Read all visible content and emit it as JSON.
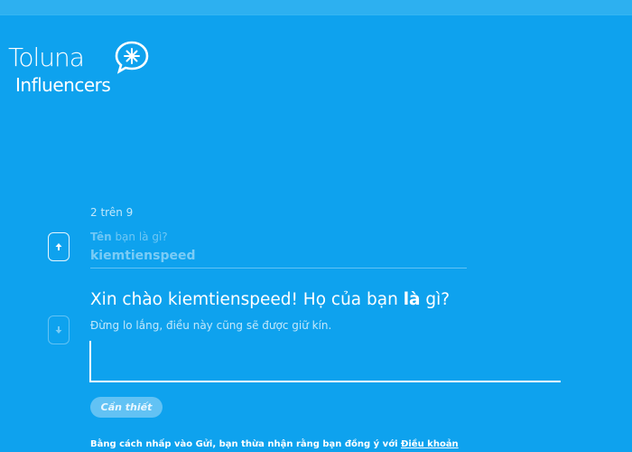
{
  "brand": {
    "line1": "Toluna",
    "line2": "Influencers"
  },
  "survey": {
    "counter": "2 trên 9",
    "previous": {
      "label_bold": "Tên",
      "label_rest": " bạn là gì?",
      "answer": "kiemtienspeed"
    },
    "current": {
      "question_start": "Xin chào kiemtienspeed! Họ của bạn ",
      "question_bold": "là",
      "question_end": " gì?",
      "hint": "Đừng lo lắng, điều này cũng sẽ được giữ kín.",
      "input_value": "",
      "input_placeholder": ""
    },
    "required_label": "Cần thiết",
    "terms_text": "Bằng cách nhấp vào Gửi, bạn thừa nhận rằng bạn đồng ý với ",
    "terms_link": "Điều khoản"
  },
  "icons": {
    "up": "arrow-up-icon",
    "down": "arrow-down-icon",
    "logo": "speech-bubble-sparkle-icon"
  },
  "colors": {
    "background": "#0ea2ee",
    "topbar": "#2db0f0",
    "text": "#ffffff"
  }
}
